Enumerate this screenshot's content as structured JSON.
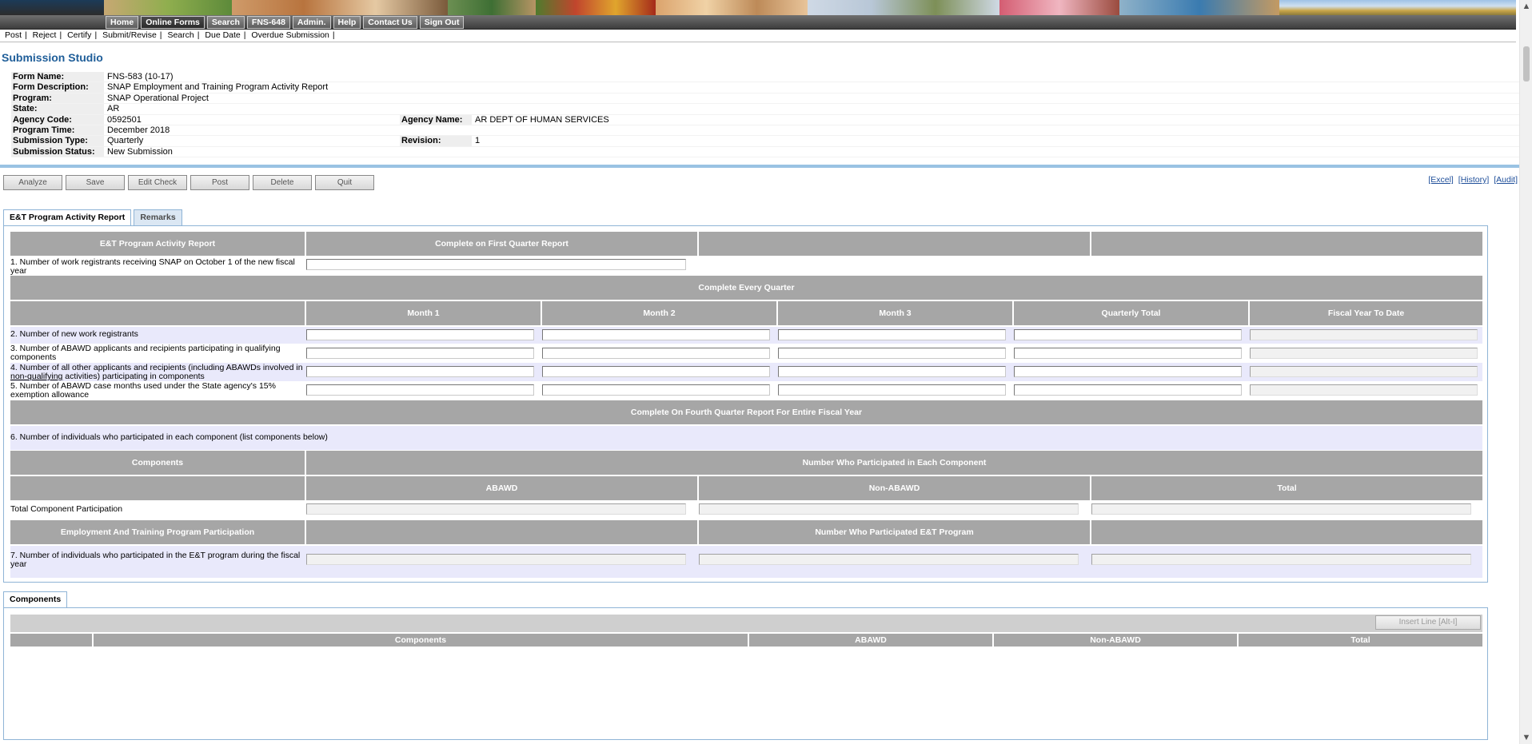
{
  "main_nav": [
    "Home",
    "Online Forms",
    "Search",
    "FNS-648",
    "Admin.",
    "Help",
    "Contact Us",
    "Sign Out"
  ],
  "sub_nav": [
    "Post",
    "Reject",
    "Certify",
    "Submit/Revise",
    "Search",
    "Due Date",
    "Overdue Submission"
  ],
  "sub_nav_sep": "|",
  "page_title": "Submission Studio",
  "meta": {
    "form_name_label": "Form Name:",
    "form_name": "FNS-583 (10-17)",
    "form_description_label": "Form Description:",
    "form_description": "SNAP Employment and Training Program Activity Report",
    "program_label": "Program:",
    "program": "SNAP Operational Project",
    "state_label": "State:",
    "state": "AR",
    "agency_code_label": "Agency Code:",
    "agency_code": "0592501",
    "agency_name_label": "Agency Name:",
    "agency_name": "AR DEPT OF HUMAN SERVICES",
    "program_time_label": "Program Time:",
    "program_time": "December 2018",
    "submission_type_label": "Submission Type:",
    "submission_type": "Quarterly",
    "revision_label": "Revision:",
    "revision": "1",
    "submission_status_label": "Submission Status:",
    "submission_status": "New Submission"
  },
  "actions": [
    "Analyze",
    "Save",
    "Edit Check",
    "Post",
    "Delete",
    "Quit"
  ],
  "right_links": [
    "[Excel]",
    "[History]",
    "[Audit]"
  ],
  "tabs_top": [
    "E&T Program Activity Report",
    "Remarks"
  ],
  "report": {
    "header1": "E&T Program Activity Report",
    "header2": "Complete on First Quarter Report",
    "row1": "1. Number of work registrants receiving SNAP on October 1 of the new fiscal year",
    "every_quarter": "Complete Every Quarter",
    "month1": "Month 1",
    "month2": "Month 2",
    "month3": "Month 3",
    "quarterly_total": "Quarterly Total",
    "fytd": "Fiscal Year To Date",
    "row2": "2. Number of new work registrants",
    "row3": "3. Number of ABAWD applicants and recipients participating in qualifying components",
    "row4_a": "4. Number of all other applicants and recipients (including ABAWDs involved in",
    "row4_u": "non-qualifying",
    "row4_b": " activities) participating in components",
    "row5": "5. Number of ABAWD case months used under the State agency's 15% exemption allowance",
    "fourth_quarter": "Complete On Fourth Quarter Report For Entire Fiscal Year",
    "row6": "6. Number of individuals who participated in each component (list components below)",
    "components": "Components",
    "num_each_component": "Number Who Participated in Each Component",
    "abawd": "ABAWD",
    "non_abawd": "Non-ABAWD",
    "total": "Total",
    "total_component": "Total Component Participation",
    "et_participation": "Employment And Training Program Participation",
    "num_et": "Number Who Participated E&T Program",
    "row7": "7. Number of individuals who participated in the E&T program during the fiscal year"
  },
  "tabs_bottom": [
    "Components"
  ],
  "components_grid": {
    "insert_line": "Insert Line [Alt-I]",
    "headers": [
      "",
      "Components",
      "ABAWD",
      "Non-ABAWD",
      "Total"
    ]
  },
  "colors": {
    "header_gray": "#a6a6a6",
    "lavender_row": "#e9e9fb",
    "title_blue": "#1f5e99",
    "tab_border": "#8fb4d6"
  },
  "icons": {
    "scroll_up": "▲",
    "scroll_down": "▼"
  }
}
